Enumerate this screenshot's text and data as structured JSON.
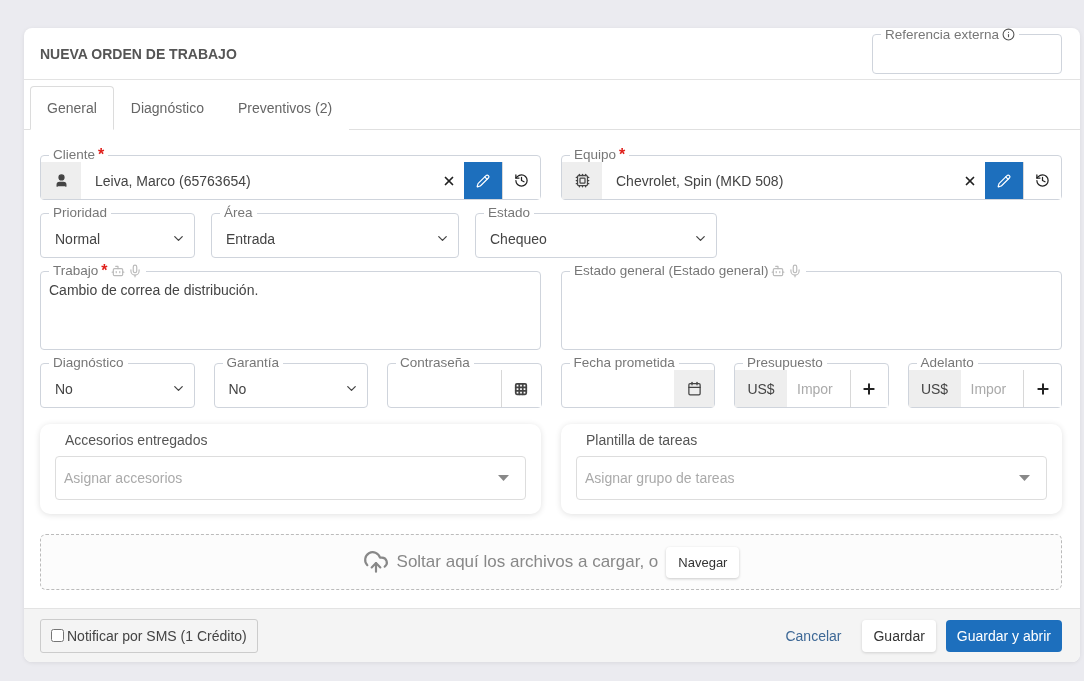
{
  "header": {
    "title": "NUEVA ORDEN DE TRABAJO",
    "external_reference": {
      "label": "Referencia externa"
    }
  },
  "tabs": [
    {
      "label": "General",
      "selected": true
    },
    {
      "label": "Diagnóstico",
      "selected": false
    },
    {
      "label": "Preventivos (2)",
      "selected": false
    }
  ],
  "lookups": [
    {
      "kind": "person",
      "label": "Cliente",
      "required_mark": "*",
      "value": "Leiva, Marco (65763654)"
    },
    {
      "kind": "device",
      "label": "Equipo",
      "required_mark": "*",
      "value": "Chevrolet, Spin (MKD 508)"
    }
  ],
  "selects": [
    {
      "label": "Prioridad",
      "value": "Normal"
    },
    {
      "label": "Área",
      "value": "Entrada"
    },
    {
      "label": "Estado",
      "value": "Chequeo"
    }
  ],
  "text_areas": [
    {
      "label": "Trabajo",
      "required_mark": "*",
      "voice_tools": true,
      "value": "Cambio de correa de distribución."
    },
    {
      "label": "Estado general (Estado general)",
      "voice_tools": true
    }
  ],
  "details": [
    {
      "kind": "select",
      "label": "Diagnóstico",
      "value": "No"
    },
    {
      "kind": "select",
      "label": "Garantía",
      "value": "No"
    },
    {
      "kind": "keypad",
      "label": "Contraseña"
    },
    {
      "kind": "date",
      "label": "Fecha prometida"
    },
    {
      "kind": "money",
      "label": "Presupuesto",
      "currency": "US$",
      "placeholder": "Impor"
    },
    {
      "kind": "money",
      "label": "Adelanto",
      "currency": "US$",
      "placeholder": "Impor"
    }
  ],
  "cards": [
    {
      "title": "Accesorios entregados",
      "placeholder": "Asignar accesorios"
    },
    {
      "title": "Plantilla de tareas",
      "placeholder": "Asignar grupo de tareas"
    }
  ],
  "dropzone": {
    "text": "Soltar aquí los archivos a cargar, o",
    "button": "Navegar"
  },
  "footer": {
    "sms": {
      "label": "Notificar por SMS (1 Crédito)",
      "checked": false
    },
    "buttons": [
      {
        "label": "Cancelar",
        "kind": "link"
      },
      {
        "label": "Guardar",
        "kind": "secondary"
      },
      {
        "label": "Guardar y abrir",
        "kind": "primary"
      }
    ]
  }
}
